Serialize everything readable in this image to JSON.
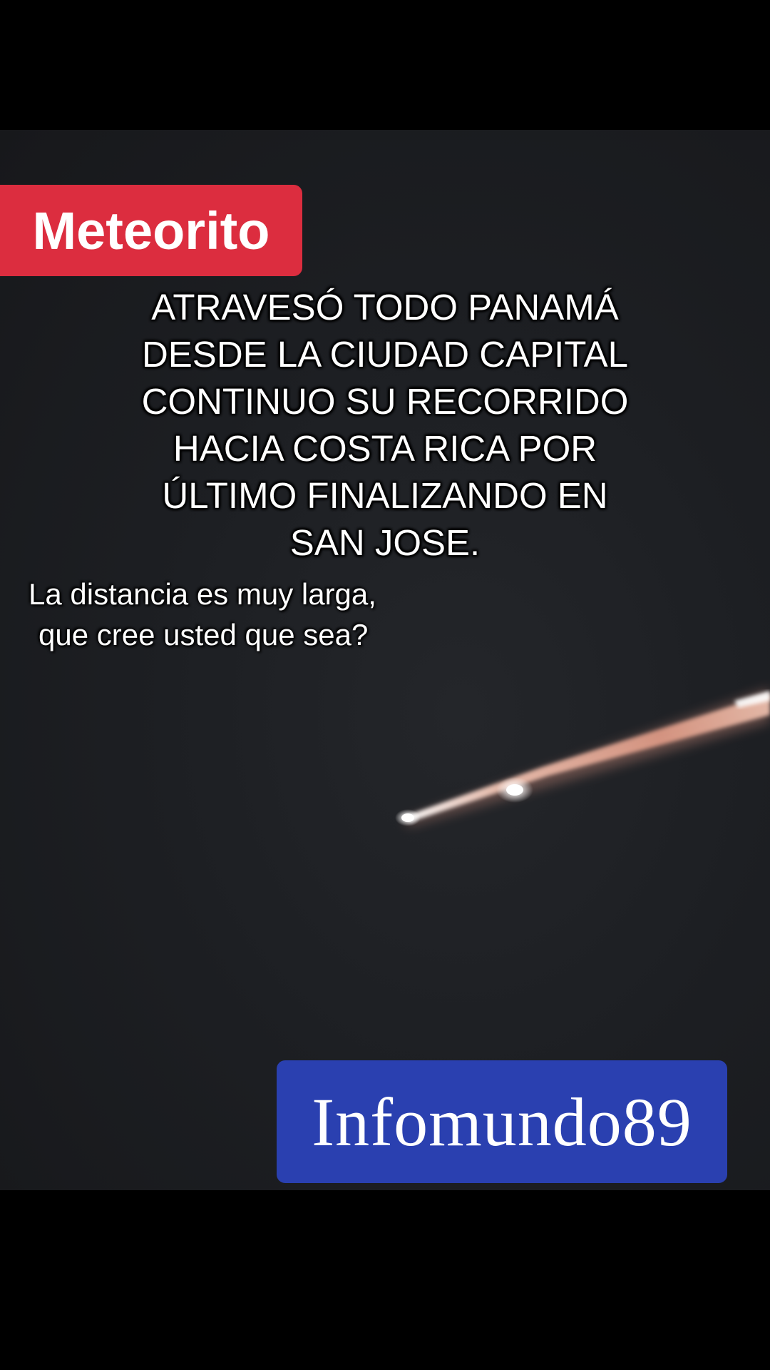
{
  "badge": {
    "label": "Meteorito",
    "color": "#dc2d3f"
  },
  "headline": {
    "lines": [
      "ATRAVESÓ TODO PANAMÁ",
      "DESDE LA CIUDAD CAPITAL",
      "CONTINUO SU RECORRIDO",
      "HACIA COSTA RICA POR",
      "ÚLTIMO FINALIZANDO EN",
      "SAN JOSE."
    ]
  },
  "question": {
    "line1": "La distancia es muy larga,",
    "line2": "que cree usted que sea?"
  },
  "watermark": {
    "label": "Infomundo89",
    "color": "#2a40b0"
  },
  "scene": {
    "subject": "meteor-streak-icon"
  }
}
